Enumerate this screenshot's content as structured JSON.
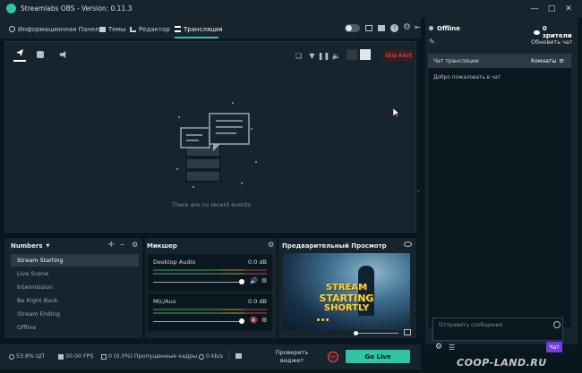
{
  "window": {
    "title": "Streamlabs OBS - Version: 0.11.3"
  },
  "nav": {
    "dashboard": "Информационная Панель",
    "themes": "Темы",
    "editor": "Редактор",
    "broadcast": "Трансляция"
  },
  "events": {
    "skip_alert": "Skip Alert",
    "empty_text": "There are no recent events"
  },
  "scenes": {
    "title": "Numbers",
    "items": [
      "Stream Starting",
      "Live Scene",
      "Intermission",
      "Be Right Back",
      "Stream Ending",
      "Offline"
    ],
    "selected": "Stream Starting"
  },
  "mixer": {
    "title": "Микшер",
    "sources": [
      {
        "name": "Desktop Audio",
        "db": "0.0 dB"
      },
      {
        "name": "Mic/Aux",
        "db": "0.0 dB"
      }
    ]
  },
  "preview": {
    "title": "Предварительный Просмотр",
    "line1": "STREAM",
    "line2": "STARTING",
    "line3": "SHORTLY"
  },
  "chat": {
    "status": "Offline",
    "viewers": "0 зрители",
    "refresh": "Обновить чат",
    "header": "Чат трансляции",
    "rooms": "Комнаты",
    "welcome": "Добро пожаловать в чат",
    "input_placeholder": "Отправить сообщение",
    "send": "Чат"
  },
  "status": {
    "cpu": "53.8% ЦП",
    "fps": "30.00 FPS",
    "dropped": "0 (0.0%) Пропущенные кадры",
    "bitrate": "0 kb/s",
    "test_widget": "Проверить виджет",
    "rec": "REC",
    "go_live": "Go Live"
  },
  "watermark": "COOP-LAND.RU",
  "colors": {
    "accent": "#31c3a2",
    "danger": "#f2545b",
    "panel": "#17242d",
    "background": "#09161d",
    "chat_send": "#6e3fdc"
  }
}
